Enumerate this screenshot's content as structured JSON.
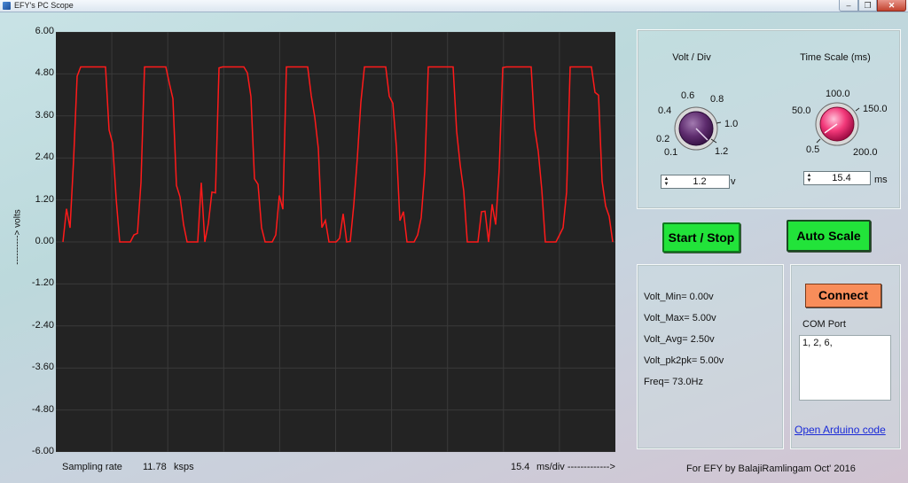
{
  "window": {
    "title": "EFY's PC Scope",
    "minimize_glyph": "‒",
    "maximize_glyph": "❐",
    "close_glyph": "✕"
  },
  "colors": {
    "plot_background": "#232323",
    "trace": "#ff1a1a",
    "grid": "#3a3a3a",
    "green_button": "#22e33a",
    "connect_button": "#f88d5a",
    "link": "#1a2ad8"
  },
  "scope": {
    "ylabel": "----------> volts",
    "y_ticks": [
      "6.00",
      "4.80",
      "3.60",
      "2.40",
      "1.20",
      "0.00",
      "-1.20",
      "-2.40",
      "-3.60",
      "-4.80",
      "-6.00"
    ]
  },
  "chart_data": {
    "type": "line",
    "series": [
      {
        "values": [
          0,
          0.5,
          1,
          2,
          4.6,
          5,
          5,
          5,
          5,
          5,
          5,
          5,
          4.7,
          3.8,
          2.4,
          1.2,
          0.4,
          0,
          0,
          0,
          0.2,
          0.8,
          1.5,
          5,
          5,
          5,
          5,
          5,
          5,
          5,
          4.6,
          3.6,
          2.2,
          1,
          0.3,
          0,
          0,
          0,
          0.3,
          1.1
        ]
      }
    ],
    "ylim": [
      -6,
      6
    ],
    "grid": true
  },
  "controls": {
    "volt_div": {
      "label": "Volt / Div",
      "dial_values": [
        "0.1",
        "0.2",
        "0.4",
        "0.6",
        "0.8",
        "1.0",
        "1.2"
      ],
      "value": "1.2",
      "unit": "v"
    },
    "time_scale": {
      "label": "Time Scale (ms)",
      "dial_values": [
        "0.5",
        "50.0",
        "100.0",
        "150.0",
        "200.0"
      ],
      "value": "15.4",
      "unit": "ms"
    },
    "spin_up": "▲",
    "spin_down": "▼",
    "start_stop_label": "Start / Stop",
    "auto_scale_label": "Auto Scale"
  },
  "stats": {
    "volt_min": "Volt_Min= 0.00v",
    "volt_max": "Volt_Max= 5.00v",
    "volt_avg": "Volt_Avg= 2.50v",
    "volt_pk2pk": "Volt_pk2pk= 5.00v",
    "freq": "Freq= 73.0Hz"
  },
  "connection": {
    "connect_label": "Connect",
    "com_label": "COM Port",
    "com_ports": "1, 2, 6,",
    "arduino_link": "Open Arduino code"
  },
  "footer": {
    "sampling_label": "Sampling rate",
    "sampling_value": "11.78",
    "sampling_unit": "ksps",
    "ms_div_value": "15.4",
    "ms_div_label": "ms/div ------------->",
    "credit": "For EFY by BalajiRamlingam Oct' 2016"
  }
}
